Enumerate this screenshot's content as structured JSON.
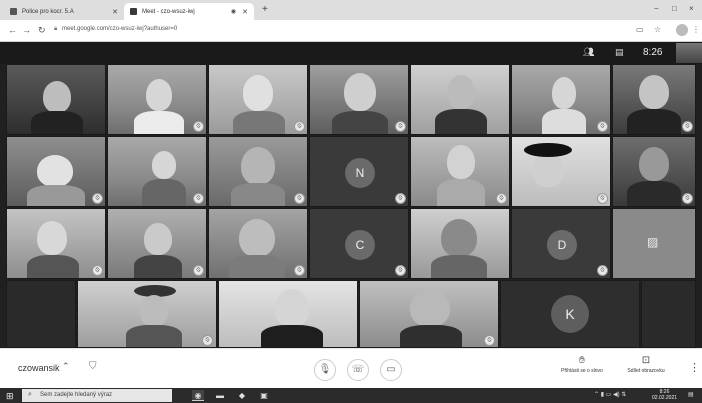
{
  "browser": {
    "tabs": [
      {
        "title": "Police pro kocr. 5.A",
        "active": false
      },
      {
        "title": "Meet - czo-wsuz-iwj",
        "active": true
      }
    ],
    "url": "meet.google.com/czo-wsuz-iwj?authuser=0",
    "window_controls": [
      "−",
      "□",
      "×"
    ]
  },
  "meet": {
    "clock": "8:26",
    "meeting_code": "czowansik",
    "avatars": [
      "N",
      "C",
      "D",
      "K"
    ],
    "controls": {
      "raise_hand_label": "Přihlásit se o slovo",
      "present_label": "Sdílet obrazovku"
    }
  },
  "taskbar": {
    "search_placeholder": "Sem zadejte hledaný výraz",
    "time": "8:26",
    "date": "02.02.2021"
  }
}
